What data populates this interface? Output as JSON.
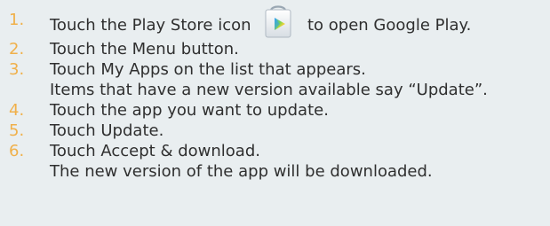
{
  "steps": [
    {
      "num": "1.",
      "before_icon": "Touch the Play Store icon",
      "icon": "play-store-icon",
      "after_icon": "to open Google Play."
    },
    {
      "num": "2.",
      "text": "Touch the Menu button."
    },
    {
      "num": "3.",
      "text": "Touch My Apps on the list that appears.",
      "detail": "Items that have a new version available say “Update”."
    },
    {
      "num": "4.",
      "text": "Touch the app you want to update."
    },
    {
      "num": "5.",
      "text": "Touch Update."
    },
    {
      "num": "6.",
      "text": "Touch Accept & download.",
      "detail": "The new version of the app will be downloaded."
    }
  ],
  "colors": {
    "background": "#e9eef0",
    "step_number": "#f0b04a",
    "text": "#2f2f2f"
  }
}
